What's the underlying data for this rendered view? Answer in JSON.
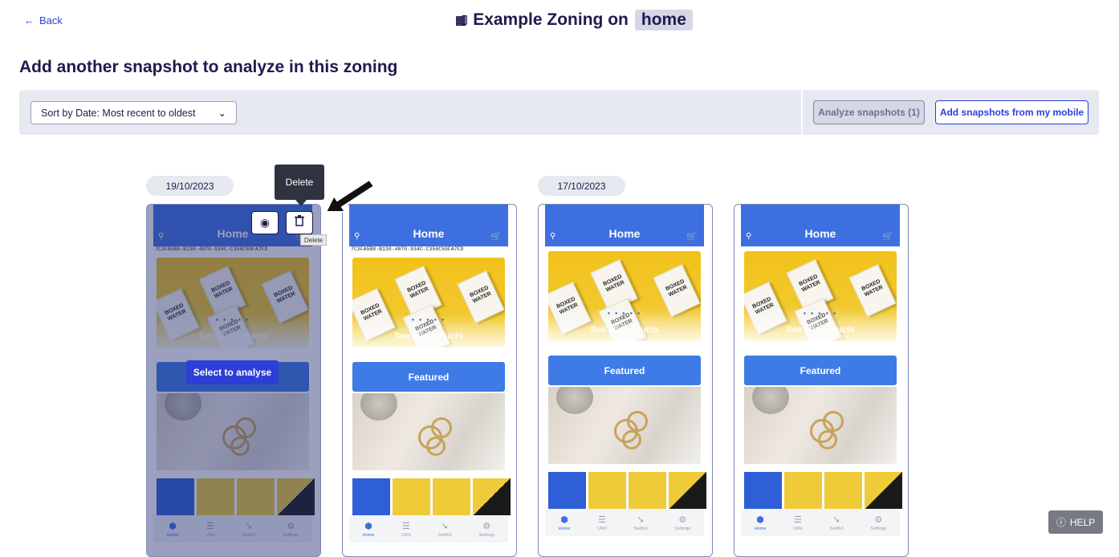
{
  "header": {
    "back_label": "Back",
    "title_prefix": "Example Zoning on",
    "page_tag": "home"
  },
  "section_title": "Add another snapshot to analyze in this zoning",
  "toolbar": {
    "sort_value": "Sort by Date: Most recent to oldest",
    "analyze_label": "Analyze snapshots (1)",
    "add_mobile_label": "Add snapshots from my mobile"
  },
  "groups": [
    {
      "date": "19/10/2023"
    },
    {
      "date": "17/10/2023"
    }
  ],
  "snapshots": [
    {
      "header_title": "Home",
      "uuid": "7C3FA5B8-B130-4870-934C-C358C59FA7FD",
      "see_all": "See all products",
      "featured": "Featured",
      "selected": true
    },
    {
      "header_title": "Home",
      "uuid": "7C3FA5B8-B130-4870-934C-C358C59FA7FD",
      "see_all": "See all products",
      "featured": "Featured",
      "selected": false
    },
    {
      "header_title": "Home",
      "uuid": "",
      "see_all": "See all products",
      "featured": "Featured",
      "selected": false
    },
    {
      "header_title": "Home",
      "uuid": "",
      "see_all": "See all products",
      "featured": "Featured",
      "selected": false
    }
  ],
  "tabs": [
    "Home",
    "UIKit",
    "SwiftUI",
    "Settings"
  ],
  "overlay": {
    "select_label": "Select to analyse",
    "delete_tooltip": "Delete",
    "delete_mini_tooltip": "Delete"
  },
  "help_label": "HELP",
  "colors": {
    "accent": "#2d3fd6",
    "app_blue": "#3e6fe0",
    "text_dark": "#1f1a4d",
    "toolbar_bg": "#e6e9ef"
  }
}
